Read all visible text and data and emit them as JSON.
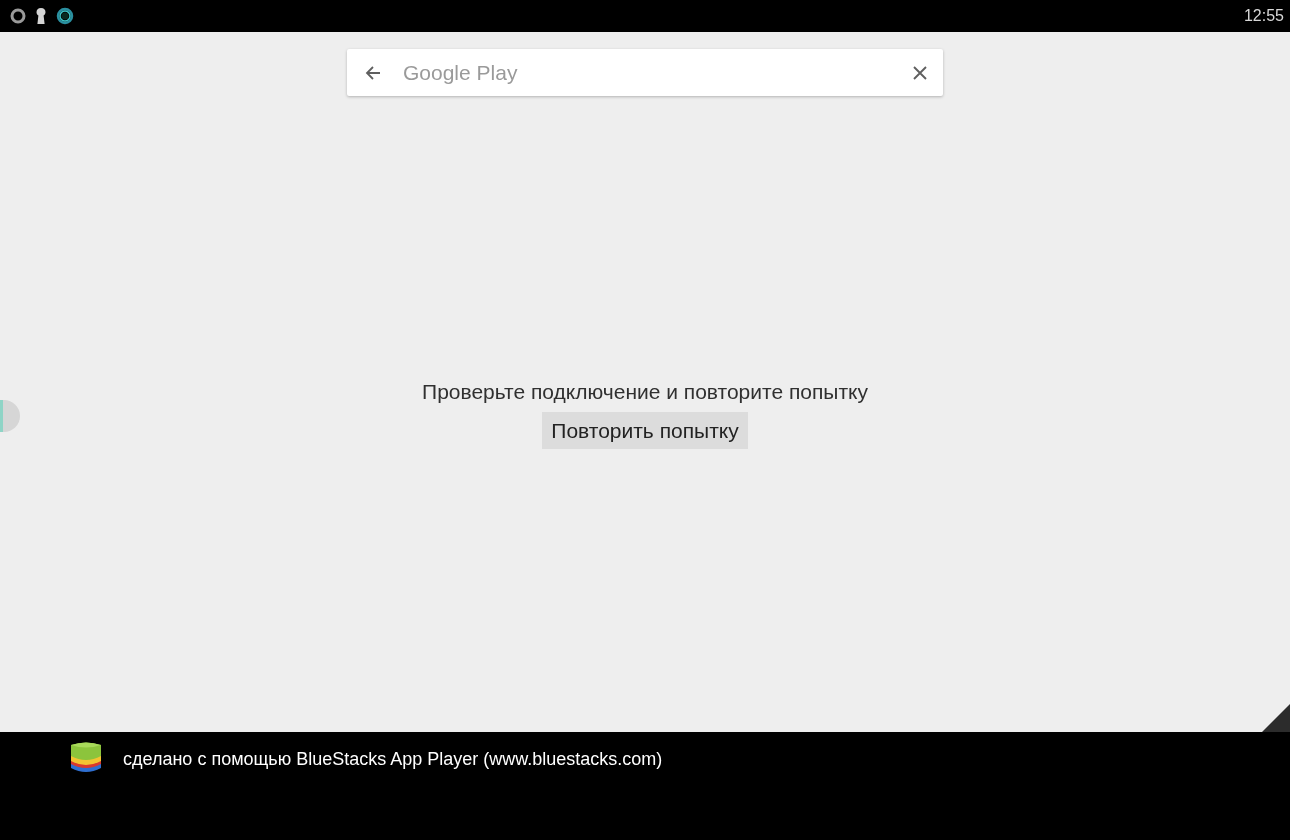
{
  "status_bar": {
    "time": "12:55"
  },
  "search_bar": {
    "placeholder": "Google Play"
  },
  "error": {
    "message": "Проверьте подключение и повторите попытку",
    "retry_button": "Повторить попытку"
  },
  "footer": {
    "text": "сделано с помощью BlueStacks App Player (www.bluestacks.com)"
  }
}
